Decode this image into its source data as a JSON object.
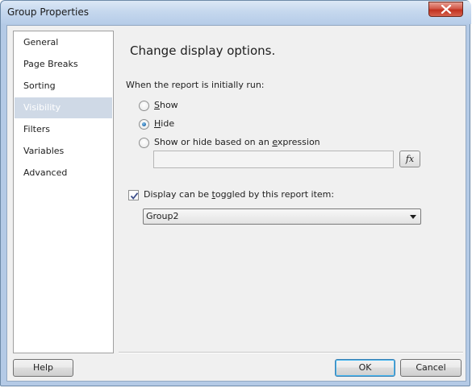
{
  "window": {
    "title": "Group Properties"
  },
  "nav": {
    "items": [
      {
        "label": "General",
        "selected": false
      },
      {
        "label": "Page Breaks",
        "selected": false
      },
      {
        "label": "Sorting",
        "selected": false
      },
      {
        "label": "Visibility",
        "selected": true
      },
      {
        "label": "Filters",
        "selected": false
      },
      {
        "label": "Variables",
        "selected": false
      },
      {
        "label": "Advanced",
        "selected": false
      }
    ]
  },
  "page": {
    "heading": "Change display options.",
    "run_label": "When the report is initially run:",
    "options": {
      "show": {
        "pre": "",
        "key": "S",
        "post": "how",
        "selected": false
      },
      "hide": {
        "pre": "",
        "key": "H",
        "post": "ide",
        "selected": true
      },
      "expression": {
        "pre": "Show or hide based on an ",
        "key": "e",
        "post": "xpression",
        "selected": false
      }
    },
    "expression_value": "",
    "fx_label": "fx",
    "toggle": {
      "checked": true,
      "pre": "Display can be ",
      "key": "t",
      "post": "oggled by this report item:",
      "selected_item": "Group2"
    }
  },
  "buttons": {
    "help": "Help",
    "ok": "OK",
    "cancel": "Cancel"
  },
  "colors": {
    "selected_nav_bg": "#cfd9e6",
    "close_button": "#c1311f"
  }
}
